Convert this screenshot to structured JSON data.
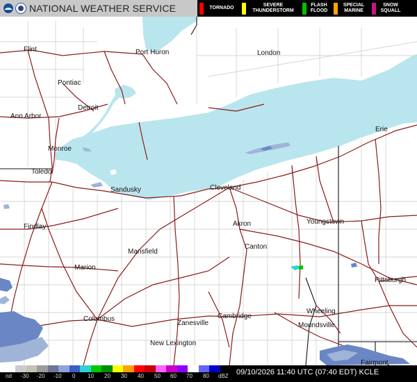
{
  "header": {
    "title": "NATIONAL WEATHER SERVICE",
    "legend": [
      {
        "label": "TORNADO",
        "color": "#ff0000"
      },
      {
        "label": "SEVERE THUNDERSTORM",
        "color": "#ffff00"
      },
      {
        "label": "FLASH FLOOD",
        "color": "#00c000"
      },
      {
        "label": "SPECIAL MARINE",
        "color": "#ffa500"
      },
      {
        "label": "SNOW SQUALL",
        "color": "#c71585"
      }
    ]
  },
  "colors": {
    "lake": "#b9e6ee",
    "state_border": "#111111",
    "county_line": "#c9c9c9",
    "highway": "#8b1a1a",
    "radar_light": "#a0b4d8",
    "radar_mid": "#6a86c4"
  },
  "cities": {
    "flint": "Flint",
    "port_huron": "Port Huron",
    "london": "London",
    "pontiac": "Pontiac",
    "detroit": "Detroit",
    "ann_arbor": "Ann Arbor",
    "monroe": "Monroe",
    "toledo": "Toledo",
    "sandusky": "Sandusky",
    "cleveland": "Cleveland",
    "erie": "Erie",
    "findlay": "Findlay",
    "akron": "Akron",
    "youngstown": "Youngstown",
    "canton": "Canton",
    "mansfield": "Mansfield",
    "marion": "Marion",
    "pittsburgh": "Pittsburgh",
    "columbus": "Columbus",
    "zanesville": "Zanesville",
    "cambridge": "Cambridge",
    "wheeling": "Wheeling",
    "moundsville": "Moundsville",
    "new_lexington": "New Lexington",
    "fairmont": "Fairmont"
  },
  "footer": {
    "scale_labels": [
      "nd",
      "-30",
      "-20",
      "-10",
      "0",
      "10",
      "20",
      "30",
      "40",
      "50",
      "60",
      "70",
      "80",
      "dBZ"
    ],
    "scale_colors": [
      "#ffffff",
      "#cccccc",
      "#c8c0b0",
      "#9c9c9c",
      "#6e7496",
      "#8fa3dc",
      "#3c5cc8",
      "#32d2d2",
      "#00c800",
      "#008c00",
      "#ffff00",
      "#ffa000",
      "#ff0000",
      "#c80000",
      "#ff64ff",
      "#c800c8",
      "#8c00ff",
      "#ffffff",
      "#6464ff",
      "#0000c8"
    ],
    "timestamp": "09/10/2026 11:40 UTC (07:40 EDT)  KCLE"
  }
}
